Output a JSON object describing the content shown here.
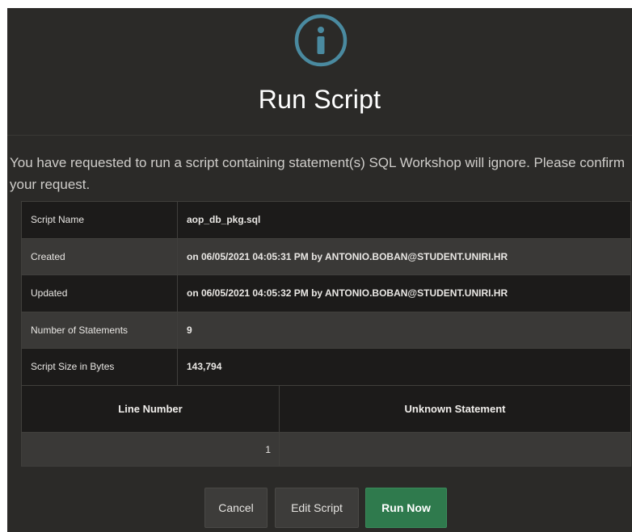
{
  "dialog": {
    "icon": "info-circle-icon",
    "title": "Run Script",
    "message": "You have requested to run a script containing statement(s) SQL Workshop will ignore. Please confirm your request."
  },
  "details": [
    {
      "label": "Script Name",
      "value": "aop_db_pkg.sql"
    },
    {
      "label": "Created",
      "value": "on 06/05/2021 04:05:31 PM by ANTONIO.BOBAN@STUDENT.UNIRI.HR"
    },
    {
      "label": "Updated",
      "value": "on 06/05/2021 04:05:32 PM by ANTONIO.BOBAN@STUDENT.UNIRI.HR"
    },
    {
      "label": "Number of Statements",
      "value": "9"
    },
    {
      "label": "Script Size in Bytes",
      "value": "143,794"
    }
  ],
  "statements": {
    "headers": [
      "Line Number",
      "Unknown Statement"
    ],
    "rows": [
      {
        "line": "1",
        "statement": ""
      }
    ]
  },
  "buttons": {
    "cancel": "Cancel",
    "edit": "Edit Script",
    "run": "Run Now"
  },
  "colors": {
    "background": "#2b2a28",
    "accent_icon": "#4a8aa0",
    "run_button": "#2f7a4d"
  }
}
